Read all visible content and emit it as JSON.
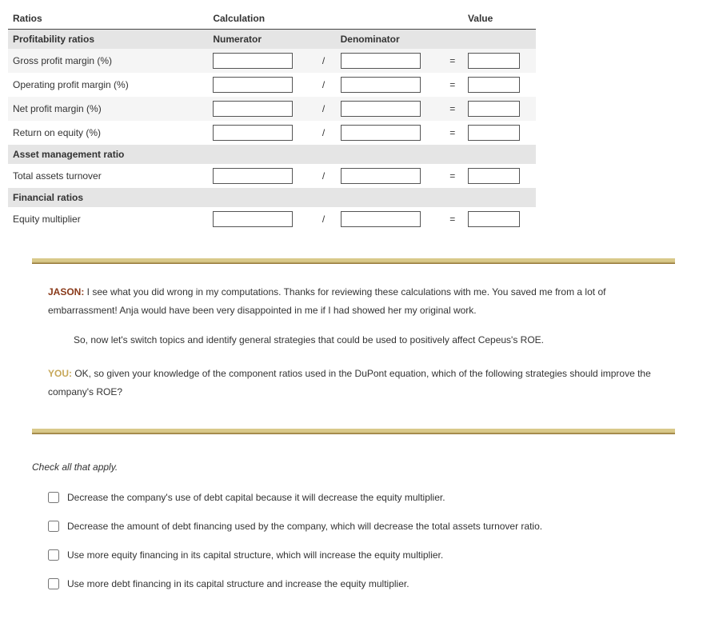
{
  "tableHeaders": {
    "ratios": "Ratios",
    "calculation": "Calculation",
    "value": "Value"
  },
  "subHeaders": {
    "profitability": "Profitability ratios",
    "numerator": "Numerator",
    "denominator": "Denominator"
  },
  "rows": {
    "gpm": "Gross profit margin (%)",
    "opm": "Operating profit margin (%)",
    "npm": "Net profit margin (%)",
    "roe": "Return on equity (%)",
    "amr_header": "Asset management ratio",
    "tat": "Total assets turnover",
    "fr_header": "Financial ratios",
    "em": "Equity multiplier"
  },
  "symbols": {
    "slash": "/",
    "equals": "="
  },
  "dialogue": {
    "jason_label": "JASON:",
    "jason_p1": " I see what you did wrong in my computations. Thanks for reviewing these calculations with me. You saved me from a lot of embarrassment! Anja would have been very disappointed in me if I had showed her my original work.",
    "jason_p2": "So, now let's switch topics and identify general strategies that could be used to positively affect Cepeus's ROE.",
    "you_label": "YOU:",
    "you_p1": " OK, so given your knowledge of the component ratios used in the DuPont equation, which of the following strategies should improve the company's ROE?"
  },
  "checkall": "Check all that apply.",
  "options": {
    "o1": "Decrease the company's use of debt capital because it will decrease the equity multiplier.",
    "o2": "Decrease the amount of debt financing used by the company, which will decrease the total assets turnover ratio.",
    "o3": "Use more equity financing in its capital structure, which will increase the equity multiplier.",
    "o4": "Use more debt financing in its capital structure and increase the equity multiplier."
  }
}
